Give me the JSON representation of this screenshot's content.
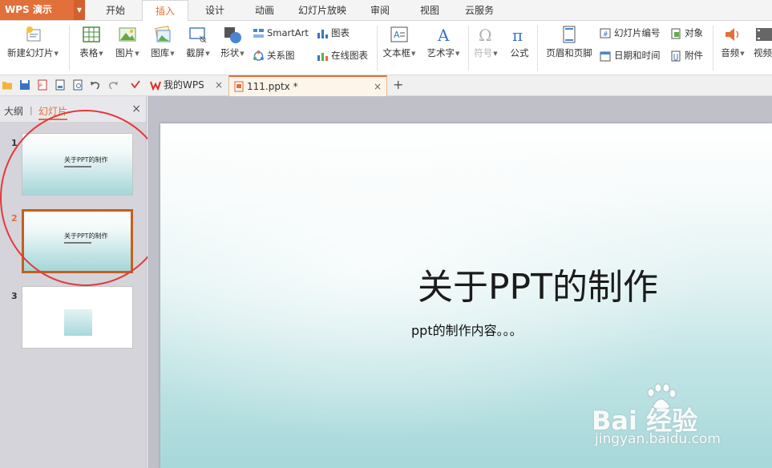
{
  "app": {
    "logo": "WPS 演示",
    "colors": {
      "accent": "#e2703a",
      "selection_circle": "#e23a3a",
      "slide_teal": "#a6d8da"
    }
  },
  "menu": {
    "tabs": [
      "开始",
      "插入",
      "设计",
      "动画",
      "幻灯片放映",
      "审阅",
      "视图",
      "云服务"
    ],
    "active": "插入"
  },
  "ribbon": {
    "new_slide": "新建幻灯片",
    "table": "表格",
    "picture": "图片",
    "gallery": "图库",
    "screenshot": "截屏",
    "shape": "形状",
    "smartart": "SmartArt",
    "chart": "图表",
    "relation": "关系图",
    "online_chart": "在线图表",
    "textbox": "文本框",
    "wordart": "艺术字",
    "symbol": "符号",
    "formula": "公式",
    "header_footer": "页眉和页脚",
    "slide_number": "幻灯片编号",
    "object": "对象",
    "datetime": "日期和时间",
    "attachment": "附件",
    "audio": "音频",
    "video": "视频"
  },
  "doc_tabs": [
    {
      "label": "我的WPS",
      "icon": "wps-logo-icon"
    },
    {
      "label": "111.pptx *",
      "icon": "pptx-file-icon"
    }
  ],
  "left_panel": {
    "tab_outline": "大纲",
    "tab_slides": "幻灯片",
    "slides": [
      {
        "num": "1",
        "title": "关于PPT的制作"
      },
      {
        "num": "2",
        "title": "关于PPT的制作"
      },
      {
        "num": "3",
        "title": ""
      }
    ]
  },
  "slide": {
    "title": "关于PPT的制作",
    "subtitle": "ppt的制作内容。。。"
  },
  "watermark": {
    "brand": "Bai 经验",
    "url": "jingyan.baidu.com"
  }
}
